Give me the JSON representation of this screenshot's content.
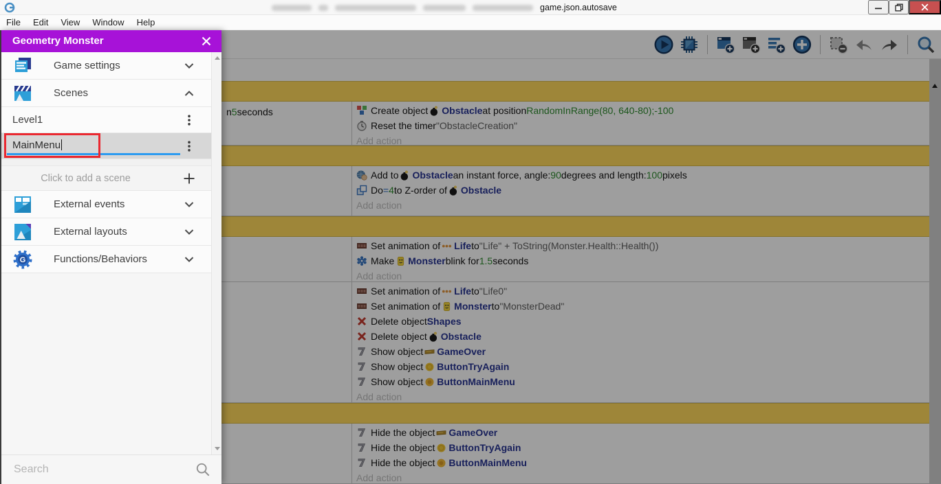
{
  "colors": {
    "accent": "#a712d8",
    "annotation": "#ea2830",
    "underline": "#2d9bf0",
    "group_bar": "#ffd95c",
    "object_name": "#283593",
    "value_green": "#2e8b2e",
    "close_button": "#c75050"
  },
  "window": {
    "title_visible": "game.json.autosave",
    "controls": [
      "minimize",
      "restore",
      "close"
    ]
  },
  "menu_bar": {
    "items": [
      "File",
      "Edit",
      "View",
      "Window",
      "Help"
    ]
  },
  "toolbar": {
    "icons": [
      "run",
      "debug",
      "|",
      "add-event",
      "add-sub-event",
      "add-comment",
      "add-new",
      "|",
      "remove-event",
      "undo",
      "redo",
      "|",
      "search"
    ]
  },
  "drawer": {
    "title": "Geometry Monster",
    "search_placeholder": "Search",
    "items": [
      {
        "kind": "section",
        "icon": "game-settings",
        "label": "Game settings",
        "chevron": "down"
      },
      {
        "kind": "section",
        "icon": "scenes",
        "label": "Scenes",
        "chevron": "up"
      },
      {
        "kind": "scene",
        "label": "Level1"
      },
      {
        "kind": "scene-edit",
        "value": "MainMenu"
      },
      {
        "kind": "spacer"
      },
      {
        "kind": "add",
        "label": "Click to add a scene"
      },
      {
        "kind": "section",
        "icon": "external-events",
        "label": "External events",
        "chevron": "down"
      },
      {
        "kind": "section",
        "icon": "external-layouts",
        "label": "External layouts",
        "chevron": "down"
      },
      {
        "kind": "section",
        "icon": "functions",
        "label": "Functions/Behaviors",
        "chevron": "down"
      }
    ]
  },
  "events": [
    {
      "type": "group"
    },
    {
      "type": "event",
      "conditions": [
        [
          {
            "t": "n ",
            "c": "p"
          },
          {
            "t": "5",
            "c": "v"
          },
          {
            "t": " seconds",
            "c": "p"
          }
        ]
      ],
      "actions": [
        {
          "icon": "create",
          "segs": [
            {
              "t": "Create object ",
              "c": "p"
            },
            {
              "icon": "bomb"
            },
            {
              "t": "Obstacle",
              "c": "o"
            },
            {
              "t": " at position ",
              "c": "p"
            },
            {
              "t": "RandomInRange(80, 640-80);-100",
              "c": "v"
            }
          ]
        },
        {
          "icon": "timer",
          "segs": [
            {
              "t": "Reset the timer ",
              "c": "p"
            },
            {
              "t": "\"ObstacleCreation\"",
              "c": "s"
            }
          ]
        },
        {
          "ghost": "Add action"
        }
      ]
    },
    {
      "type": "group"
    },
    {
      "type": "event",
      "conditions": [],
      "actions": [
        {
          "icon": "force",
          "segs": [
            {
              "t": "Add to ",
              "c": "p"
            },
            {
              "icon": "bomb"
            },
            {
              "t": "Obstacle",
              "c": "o"
            },
            {
              "t": " an instant force, angle: ",
              "c": "p"
            },
            {
              "t": "90",
              "c": "v"
            },
            {
              "t": " degrees and length: ",
              "c": "p"
            },
            {
              "t": "100",
              "c": "v"
            },
            {
              "t": " pixels",
              "c": "p"
            }
          ]
        },
        {
          "icon": "zorder",
          "segs": [
            {
              "t": "Do ",
              "c": "p"
            },
            {
              "t": "= ",
              "c": "eq"
            },
            {
              "t": "4",
              "c": "v"
            },
            {
              "t": " to Z-order of ",
              "c": "p"
            },
            {
              "icon": "bomb"
            },
            {
              "t": "Obstacle",
              "c": "o"
            }
          ]
        },
        {
          "ghost": "Add action"
        }
      ]
    },
    {
      "type": "group"
    },
    {
      "type": "event",
      "conditions": [],
      "actions": [
        {
          "icon": "anim",
          "segs": [
            {
              "t": "Set animation of ",
              "c": "p"
            },
            {
              "icon": "life"
            },
            {
              "t": "Life",
              "c": "o"
            },
            {
              "t": " to ",
              "c": "p"
            },
            {
              "t": "\"Life\" + ToString(Monster.Health::Health())",
              "c": "s"
            }
          ]
        },
        {
          "icon": "blink",
          "segs": [
            {
              "t": "Make ",
              "c": "p"
            },
            {
              "icon": "monster"
            },
            {
              "t": "Monster",
              "c": "o"
            },
            {
              "t": " blink for ",
              "c": "p"
            },
            {
              "t": "1.5",
              "c": "v"
            },
            {
              "t": " seconds",
              "c": "p"
            }
          ]
        },
        {
          "ghost": "Add action"
        }
      ]
    },
    {
      "type": "event",
      "conditions": [],
      "actions": [
        {
          "icon": "anim",
          "segs": [
            {
              "t": "Set animation of ",
              "c": "p"
            },
            {
              "icon": "life"
            },
            {
              "t": "Life",
              "c": "o"
            },
            {
              "t": " to ",
              "c": "p"
            },
            {
              "t": "\"Life0\"",
              "c": "s"
            }
          ]
        },
        {
          "icon": "anim",
          "segs": [
            {
              "t": "Set animation of ",
              "c": "p"
            },
            {
              "icon": "monster"
            },
            {
              "t": "Monster",
              "c": "o"
            },
            {
              "t": " to ",
              "c": "p"
            },
            {
              "t": "\"MonsterDead\"",
              "c": "s"
            }
          ]
        },
        {
          "icon": "delete",
          "segs": [
            {
              "t": "Delete object ",
              "c": "p"
            },
            {
              "t": "Shapes",
              "c": "o"
            }
          ]
        },
        {
          "icon": "delete",
          "segs": [
            {
              "t": "Delete object ",
              "c": "p"
            },
            {
              "icon": "bomb"
            },
            {
              "t": "Obstacle",
              "c": "o"
            }
          ]
        },
        {
          "icon": "visib",
          "segs": [
            {
              "t": "Show object ",
              "c": "p"
            },
            {
              "icon": "gameover"
            },
            {
              "t": "GameOver",
              "c": "o"
            }
          ]
        },
        {
          "icon": "visib",
          "segs": [
            {
              "t": "Show object ",
              "c": "p"
            },
            {
              "icon": "coin"
            },
            {
              "t": "ButtonTryAgain",
              "c": "o"
            }
          ]
        },
        {
          "icon": "visib",
          "segs": [
            {
              "t": "Show object ",
              "c": "p"
            },
            {
              "icon": "coin2"
            },
            {
              "t": "ButtonMainMenu",
              "c": "o"
            }
          ]
        },
        {
          "ghost": "Add action"
        }
      ]
    },
    {
      "type": "group"
    },
    {
      "type": "event",
      "conditions": [],
      "actions": [
        {
          "icon": "visib",
          "segs": [
            {
              "t": "Hide the object ",
              "c": "p"
            },
            {
              "icon": "gameover"
            },
            {
              "t": "GameOver",
              "c": "o"
            }
          ]
        },
        {
          "icon": "visib",
          "segs": [
            {
              "t": "Hide the object ",
              "c": "p"
            },
            {
              "icon": "coin"
            },
            {
              "t": "ButtonTryAgain",
              "c": "o"
            }
          ]
        },
        {
          "icon": "visib",
          "segs": [
            {
              "t": "Hide the object ",
              "c": "p"
            },
            {
              "icon": "coin2"
            },
            {
              "t": "ButtonMainMenu",
              "c": "o"
            }
          ]
        },
        {
          "ghost": "Add action"
        }
      ]
    }
  ]
}
